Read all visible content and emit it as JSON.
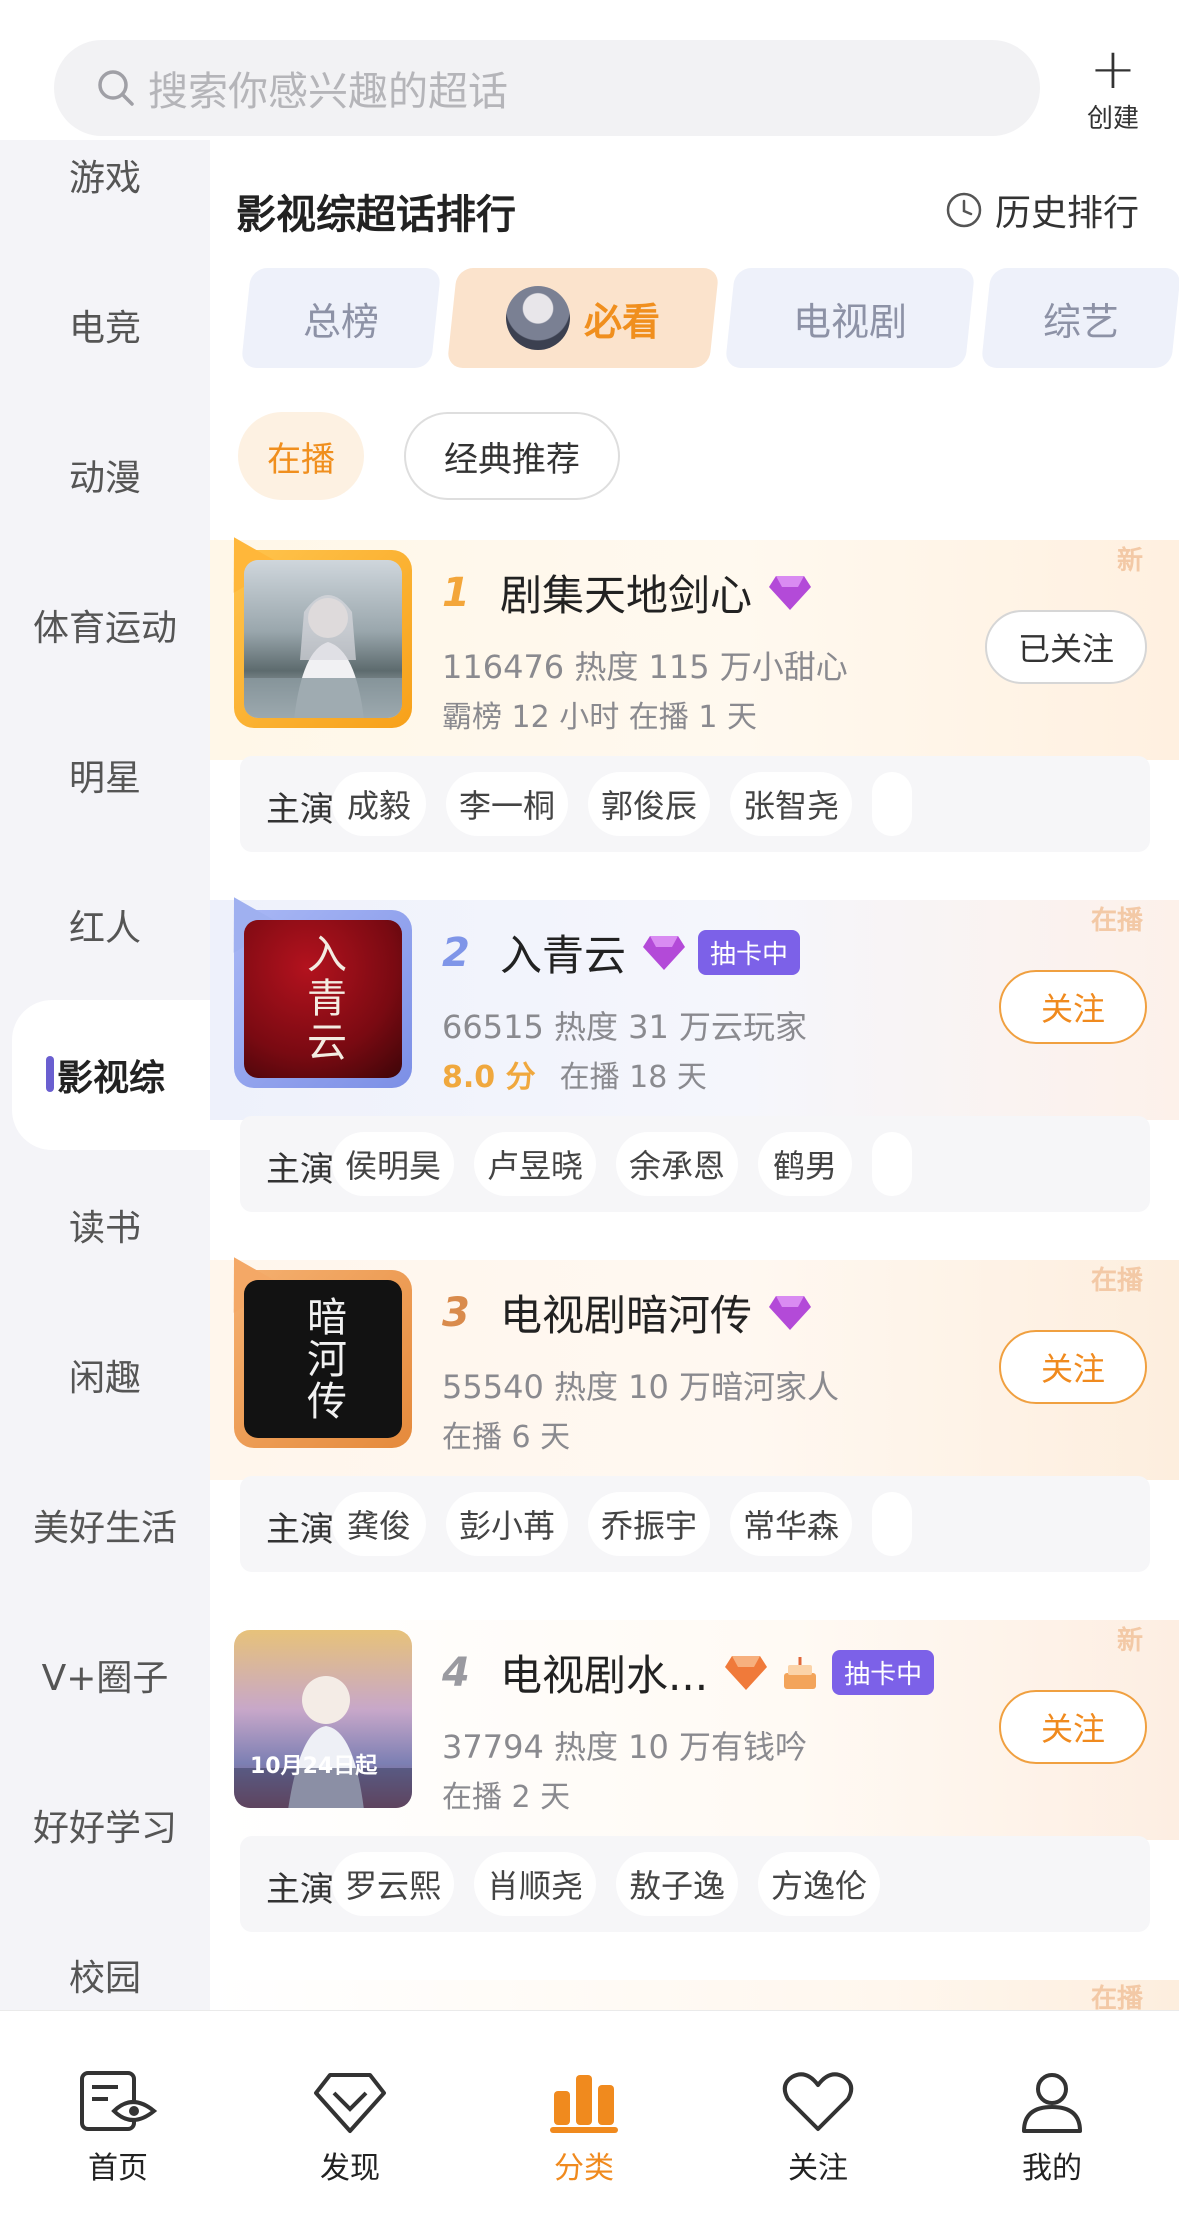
{
  "search": {
    "placeholder": "搜索你感兴趣的超话"
  },
  "create": {
    "label": "创建"
  },
  "sidebar": {
    "items": [
      {
        "label": "游戏"
      },
      {
        "label": "电竞"
      },
      {
        "label": "动漫"
      },
      {
        "label": "体育运动"
      },
      {
        "label": "明星"
      },
      {
        "label": "红人"
      },
      {
        "label": "影视综"
      },
      {
        "label": "读书"
      },
      {
        "label": "闲趣"
      },
      {
        "label": "美好生活"
      },
      {
        "label": "V+圈子"
      },
      {
        "label": "好好学习"
      },
      {
        "label": "校园"
      }
    ],
    "active": "影视综"
  },
  "section": {
    "title": "影视综超话排行",
    "history": "历史排行"
  },
  "tabs": [
    {
      "label": "总榜"
    },
    {
      "label": "必看"
    },
    {
      "label": "电视剧"
    },
    {
      "label": "综艺"
    }
  ],
  "filters": [
    {
      "label": "在播"
    },
    {
      "label": "经典推荐"
    }
  ],
  "cast_label": "主演",
  "cards": [
    {
      "rank": "1",
      "title": "剧集天地剑心",
      "tag": "新",
      "stat1": "116476 热度 115 万小甜心",
      "stat2": "霸榜 12 小时  在播 1 天",
      "follow": "已关注",
      "followed": true,
      "cast": [
        "成毅",
        "李一桐",
        "郭俊辰",
        "张智尧"
      ]
    },
    {
      "rank": "2",
      "title": "入青云",
      "tag": "在播",
      "badge": "抽卡中",
      "stat1": "66515 热度 31 万云玩家",
      "score": "8.0 分",
      "stat2": "在播 18 天",
      "follow": "关注",
      "followed": false,
      "poster_text": "入青云",
      "cast": [
        "侯明昊",
        "卢昱晓",
        "余承恩",
        "鹤男"
      ]
    },
    {
      "rank": "3",
      "title": "电视剧暗河传",
      "tag": "在播",
      "stat1": "55540 热度 10 万暗河家人",
      "stat2": "在播 6 天",
      "follow": "关注",
      "followed": false,
      "poster_text": "暗河传",
      "cast": [
        "龚俊",
        "彭小苒",
        "乔振宇",
        "常华森"
      ]
    },
    {
      "rank": "4",
      "title": "电视剧水...",
      "tag": "新",
      "badge": "抽卡中",
      "stat1": "37794 热度 10 万有钱吟",
      "stat2": "在播 2 天",
      "follow": "关注",
      "followed": false,
      "poster_text": "10月24日起",
      "cast": [
        "罗云熙",
        "肖顺尧",
        "敖子逸",
        "方逸伦"
      ]
    }
  ],
  "next_tag": "在播",
  "bottom_nav": [
    {
      "label": "首页"
    },
    {
      "label": "发现"
    },
    {
      "label": "分类"
    },
    {
      "label": "关注"
    },
    {
      "label": "我的"
    }
  ],
  "colors": {
    "accent": "#f08a1e",
    "badge": "#7c61e8",
    "sidebar_indicator": "#6a5fd0"
  }
}
